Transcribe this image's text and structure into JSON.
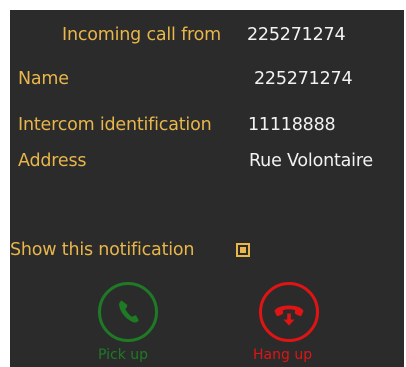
{
  "header": {
    "title": "Incoming call from",
    "caller_number": "225271274"
  },
  "details": [
    {
      "label": "Name",
      "value": "225271274"
    },
    {
      "label": "Intercom identification",
      "value": "11118888"
    },
    {
      "label": "Address",
      "value": "Rue Volontaire"
    }
  ],
  "notification": {
    "label": "Show this notification",
    "checked": true
  },
  "actions": {
    "pickup_label": "Pick up",
    "hangup_label": "Hang up"
  },
  "colors": {
    "background": "#2b2b2b",
    "accent_gold": "#e8b64a",
    "text": "#f2f2f2",
    "pickup_green": "#1e7a24",
    "hangup_red": "#e01414"
  },
  "icons": {
    "pickup": "phone-handset-icon",
    "hangup": "phone-hangup-icon"
  }
}
